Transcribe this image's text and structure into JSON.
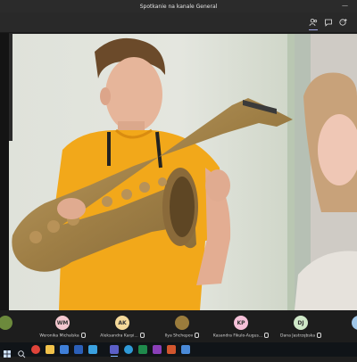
{
  "window": {
    "title": "Spotkanie na kanale General",
    "minimize_glyph": "—"
  },
  "toolbar": {
    "icons": [
      "participants-icon",
      "chat-icon",
      "reactions-icon"
    ]
  },
  "colors": {
    "accent": "#a0a4e8",
    "shirt": "#f2a81a",
    "taskbar": "#101418"
  },
  "participants": [
    {
      "initials": "",
      "name": "",
      "color": "#6c8a3c"
    },
    {
      "initials": "WM",
      "name": "Weronika Michalska",
      "color": "#f3c7cf"
    },
    {
      "initials": "AK",
      "name": "Aleksandra Karpi...",
      "color": "#f4d99a"
    },
    {
      "initials": "",
      "name": "Ilya Shchepov",
      "color": "#9a7c3c"
    },
    {
      "initials": "KP",
      "name": "Kasandra Fikulo-Augus...",
      "color": "#f5c0d8"
    },
    {
      "initials": "DJ",
      "name": "Dana Jastrzębska",
      "color": "#cfe8c8"
    },
    {
      "initials": "",
      "name": "",
      "color": "#9fc6e8"
    }
  ],
  "taskbar": {
    "apps": [
      "windows-start-icon",
      "search-icon",
      "task-view-icon",
      "chrome-icon",
      "file-explorer-icon",
      "mail-icon",
      "word-icon",
      "store-icon",
      "teams-icon",
      "edge-icon",
      "excel-icon",
      "onenote-icon",
      "powerpoint-icon",
      "photos-icon"
    ]
  }
}
